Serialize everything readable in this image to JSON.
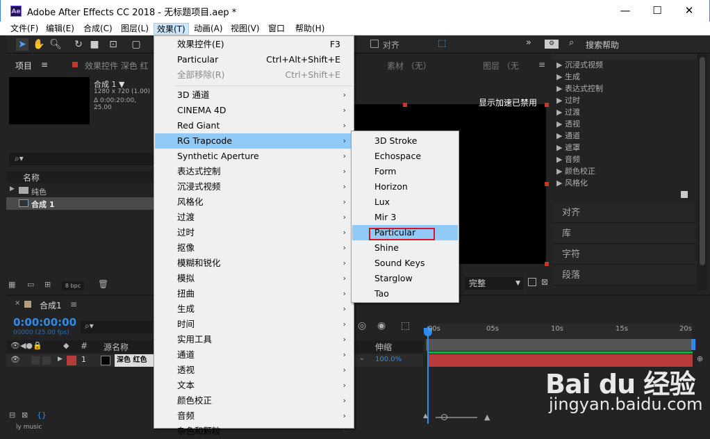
{
  "window": {
    "app_icon": "Ae",
    "title": "Adobe After Effects CC 2018 - 无标题项目.aep *",
    "minimize": "—",
    "maximize": "☐",
    "close": "✕"
  },
  "menubar": [
    "文件(F)",
    "编辑(E)",
    "合成(C)",
    "图层(L)",
    "效果(T)",
    "动画(A)",
    "视图(V)",
    "窗口",
    "帮助(H)"
  ],
  "toolbar": {
    "align_label": "对齐",
    "search_help": "搜索帮助"
  },
  "project_panel": {
    "tab": "项目",
    "effect_controls_tab": "效果控件 深色 红",
    "comp_name": "合成 1 ▼",
    "comp_res": "1280 x 720 (1.00)",
    "comp_duration": "Δ 0:00:20:00, 25.00",
    "search_placeholder": "",
    "col_name": "名称",
    "items": [
      {
        "icon": "folder-icon",
        "label": "纯色"
      },
      {
        "icon": "composition-icon",
        "label": "合成 1"
      }
    ],
    "bpc": "8 bpc"
  },
  "viewer": {
    "material_tab": "素材 （无）",
    "layer_tab": "图层 （无",
    "gpu_notice": "显示加速已禁用",
    "quality": "完整"
  },
  "effects_list": [
    "沉浸式视频",
    "生成",
    "表达式控制",
    "过时",
    "过渡",
    "透视",
    "通道",
    "遮罩",
    "音频",
    "颜色校正",
    "风格化"
  ],
  "side_tabs": [
    "对齐",
    "库",
    "字符",
    "段落"
  ],
  "timeline": {
    "tab": "合成1",
    "timecode": "0:00:00:00",
    "fps": "00000 (25.00 fps)",
    "col_hash": "#",
    "col_source": "源名称",
    "col_stretch": "伸缩",
    "layer_num": "1",
    "layer_name": "深色 红色",
    "layer_stretch": "100.0%",
    "ruler": [
      "00s",
      "05s",
      "10s",
      "15s",
      "20s"
    ],
    "bottom_text": "ly music"
  },
  "effect_menu": {
    "items": [
      {
        "label": "效果控件(E)",
        "shortcut": "F3",
        "disabled": false
      },
      {
        "label": "Particular",
        "shortcut": "Ctrl+Alt+Shift+E",
        "disabled": false
      },
      {
        "label": "全部移除(R)",
        "shortcut": "Ctrl+Shift+E",
        "disabled": true
      },
      {
        "label": "3D 通道",
        "submenu": true
      },
      {
        "label": "CINEMA 4D",
        "submenu": true
      },
      {
        "label": "Red Giant",
        "submenu": true
      },
      {
        "label": "RG Trapcode",
        "submenu": true,
        "highlighted": true
      },
      {
        "label": "Synthetic Aperture",
        "submenu": true
      },
      {
        "label": "表达式控制",
        "submenu": true
      },
      {
        "label": "沉浸式视频",
        "submenu": true
      },
      {
        "label": "风格化",
        "submenu": true
      },
      {
        "label": "过渡",
        "submenu": true
      },
      {
        "label": "过时",
        "submenu": true
      },
      {
        "label": "抠像",
        "submenu": true
      },
      {
        "label": "模糊和锐化",
        "submenu": true
      },
      {
        "label": "模拟",
        "submenu": true
      },
      {
        "label": "扭曲",
        "submenu": true
      },
      {
        "label": "生成",
        "submenu": true
      },
      {
        "label": "时间",
        "submenu": true
      },
      {
        "label": "实用工具",
        "submenu": true
      },
      {
        "label": "通道",
        "submenu": true
      },
      {
        "label": "透视",
        "submenu": true
      },
      {
        "label": "文本",
        "submenu": true
      },
      {
        "label": "颜色校正",
        "submenu": true
      },
      {
        "label": "音频",
        "submenu": true
      },
      {
        "label": "杂色和颗粒",
        "submenu": true
      }
    ]
  },
  "trapcode_submenu": [
    "3D Stroke",
    "Echospace",
    "Form",
    "Horizon",
    "Lux",
    "Mir 3",
    "Particular",
    "Shine",
    "Sound Keys",
    "Starglow",
    "Tao"
  ],
  "selected_submenu_item": "Particular",
  "watermark": {
    "brand": "Bai du 经验",
    "url": "jingyan.baidu.com"
  },
  "colors": {
    "menu_highlight": "#91c9f7",
    "selection_box": "#e0102a",
    "timecode_blue": "#2d8ceb",
    "layer_bar": "#b83a3a"
  }
}
